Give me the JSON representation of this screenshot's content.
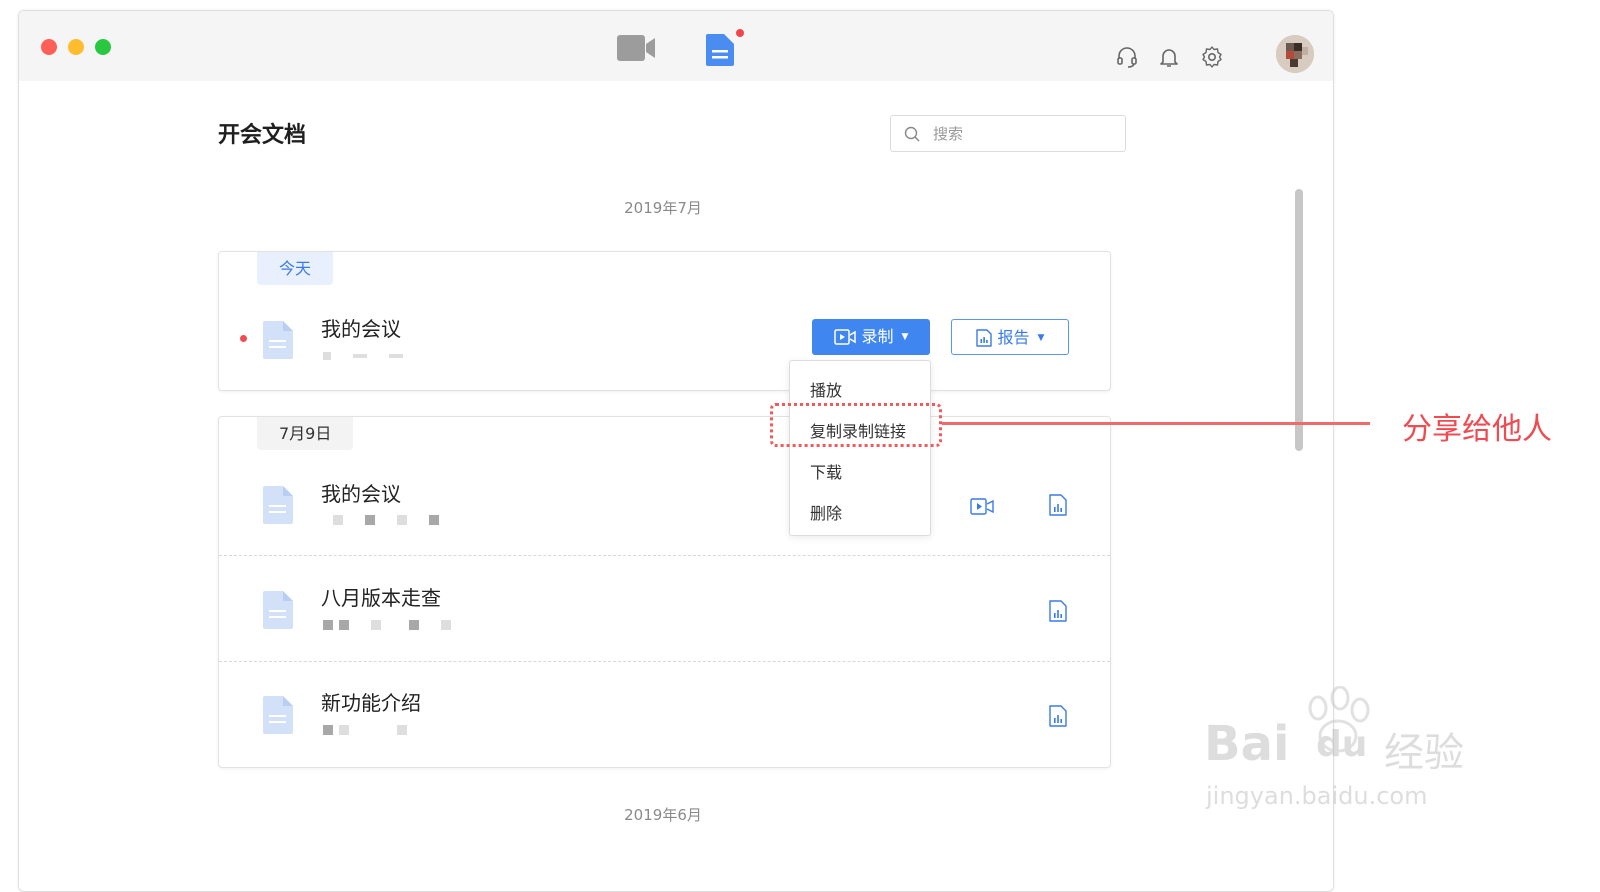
{
  "titlebar": {
    "nav": [
      {
        "icon": "video-camera-icon"
      },
      {
        "icon": "document-icon",
        "has_badge": true
      }
    ],
    "icons": [
      "headset-icon",
      "bell-icon",
      "gear-icon"
    ]
  },
  "page": {
    "title": "开会文档"
  },
  "search": {
    "placeholder": "搜索"
  },
  "months": [
    "2019年7月",
    "2019年6月"
  ],
  "groups": [
    {
      "date_label": "今天",
      "meetings": [
        {
          "title": "我的会议",
          "unread": true,
          "actions": [
            "录制",
            "报告"
          ]
        }
      ]
    },
    {
      "date_label": "7月9日",
      "meetings": [
        {
          "title": "我的会议",
          "has_recording": true,
          "has_report": true
        },
        {
          "title": "八月版本走查",
          "has_recording": false,
          "has_report": true
        },
        {
          "title": "新功能介绍",
          "has_recording": false,
          "has_report": true
        }
      ]
    }
  ],
  "buttons": {
    "record_label": "录制",
    "report_label": "报告"
  },
  "record_menu": {
    "items": [
      "播放",
      "复制录制链接",
      "下载",
      "删除"
    ],
    "highlighted_index": 1
  },
  "annotation": {
    "text": "分享给他人",
    "color": "#ef4b50"
  },
  "watermark": {
    "brand": "Bai",
    "brand_tail": "du",
    "cn": "经验",
    "url": "jingyan.baidu.com"
  },
  "colors": {
    "accent": "#3f86f1",
    "unread_dot": "#ef4b50",
    "traffic": [
      "#ff5f57",
      "#febc2e",
      "#28c840"
    ]
  }
}
